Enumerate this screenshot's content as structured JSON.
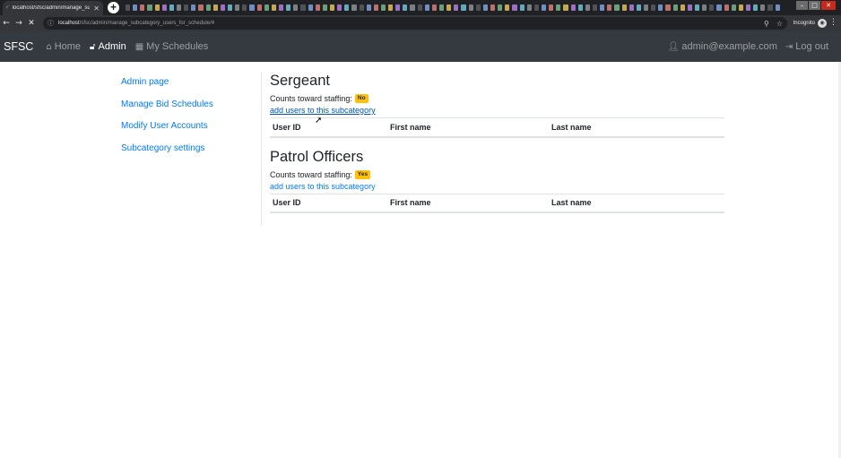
{
  "browser": {
    "tab_title": "localhost/sfsc/admin/manage_su",
    "url_host": "localhost",
    "url_path": "/sfsc/admin/manage_subcategory_users_for_schedule/4",
    "profile_label": "Incognito"
  },
  "navbar": {
    "brand": "SFSC",
    "home_label": "Home",
    "admin_label": "Admin",
    "schedules_label": "My Schedules",
    "user_email": "admin@example.com",
    "logout_label": "Log out"
  },
  "sidebar": {
    "items": [
      {
        "label": "Admin page"
      },
      {
        "label": "Manage Bid Schedules"
      },
      {
        "label": "Modify User Accounts"
      },
      {
        "label": "Subcategory settings"
      }
    ]
  },
  "subcategories": [
    {
      "title": "Sergeant",
      "counts_label": "Counts toward staffing:",
      "counts_value": "No",
      "add_link": "add users to this subcategory",
      "columns": [
        "User ID",
        "First name",
        "Last name"
      ]
    },
    {
      "title": "Patrol Officers",
      "counts_label": "Counts toward staffing:",
      "counts_value": "Yes",
      "add_link": "add users to this subcategory",
      "columns": [
        "User ID",
        "First name",
        "Last name"
      ]
    }
  ],
  "colors": {
    "navbar_bg": "#343a40",
    "link": "#007bff",
    "badge_warning": "#ffc107"
  }
}
